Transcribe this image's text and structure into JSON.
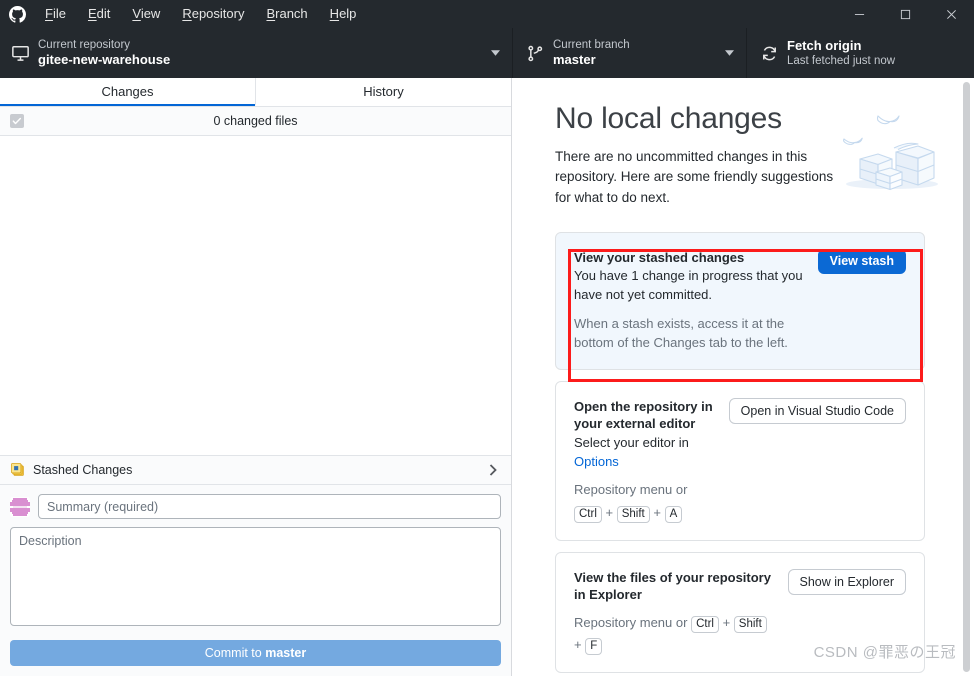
{
  "titlebar": {
    "logo_icon": "github-octocat-icon",
    "menus": [
      {
        "label": "File",
        "accel": "F"
      },
      {
        "label": "Edit",
        "accel": "E"
      },
      {
        "label": "View",
        "accel": "V"
      },
      {
        "label": "Repository",
        "accel": "R"
      },
      {
        "label": "Branch",
        "accel": "B"
      },
      {
        "label": "Help",
        "accel": "H"
      }
    ],
    "window_controls": {
      "minimize_icon": "minimize-icon",
      "maximize_icon": "maximize-icon",
      "close_icon": "close-icon"
    }
  },
  "toolbar": {
    "repository": {
      "icon": "desktop-screen-icon",
      "label": "Current repository",
      "value": "gitee-new-warehouse",
      "caret_icon": "chevron-down-icon"
    },
    "branch": {
      "icon": "git-branch-icon",
      "label": "Current branch",
      "value": "master",
      "caret_icon": "chevron-down-icon"
    },
    "fetch": {
      "icon": "sync-refresh-icon",
      "label": "Fetch origin",
      "value": "Last fetched just now"
    }
  },
  "sidebar": {
    "tabs": [
      {
        "label": "Changes",
        "active": true
      },
      {
        "label": "History",
        "active": false
      }
    ],
    "changed_files": {
      "checkbox_icon": "checkmark-icon",
      "count_label": "0 changed files"
    },
    "stashed_changes": {
      "icon": "stash-cards-icon",
      "label": "Stashed Changes",
      "chevron_icon": "chevron-right-icon"
    },
    "commit_form": {
      "avatar_icon": "identicon-avatar",
      "summary_placeholder": "Summary (required)",
      "summary_value": "",
      "description_placeholder": "Description",
      "description_value": "",
      "commit_button_prefix": "Commit to ",
      "commit_button_branch": "master"
    }
  },
  "main": {
    "title": "No local changes",
    "subtitle": "There are no uncommitted changes in this repository. Here are some friendly suggestions for what to do next.",
    "illustration_icon": "boxes-and-birds-illustration",
    "cards": [
      {
        "name": "view-stashed-changes",
        "title": "View your stashed changes",
        "text": "You have 1 change in progress that you have not yet committed.",
        "note": "When a stash exists, access it at the bottom of the Changes tab to the left.",
        "button": "View stash",
        "highlighted": true
      },
      {
        "name": "open-external-editor",
        "title": "Open the repository in your external editor",
        "text_prefix": "Select your editor in ",
        "link": "Options",
        "hint_prefix": "Repository menu or ",
        "keys": [
          "Ctrl",
          "Shift",
          "A"
        ],
        "button": "Open in Visual Studio Code"
      },
      {
        "name": "show-in-explorer",
        "title": "View the files of your repository in Explorer",
        "hint_prefix": "Repository menu or ",
        "keys": [
          "Ctrl",
          "Shift",
          "F"
        ],
        "button": "Show in Explorer"
      }
    ]
  },
  "watermark": "CSDN @罪恶の王冠",
  "colors": {
    "titlebar_bg": "#24292e",
    "accent_blue": "#0366d6",
    "primary_button": "#0b69d4",
    "commit_button": "#74a9e0",
    "highlight_card_bg": "#f1f7fd",
    "annotation_red": "#fc1b1b",
    "link_blue": "#0366d6"
  }
}
